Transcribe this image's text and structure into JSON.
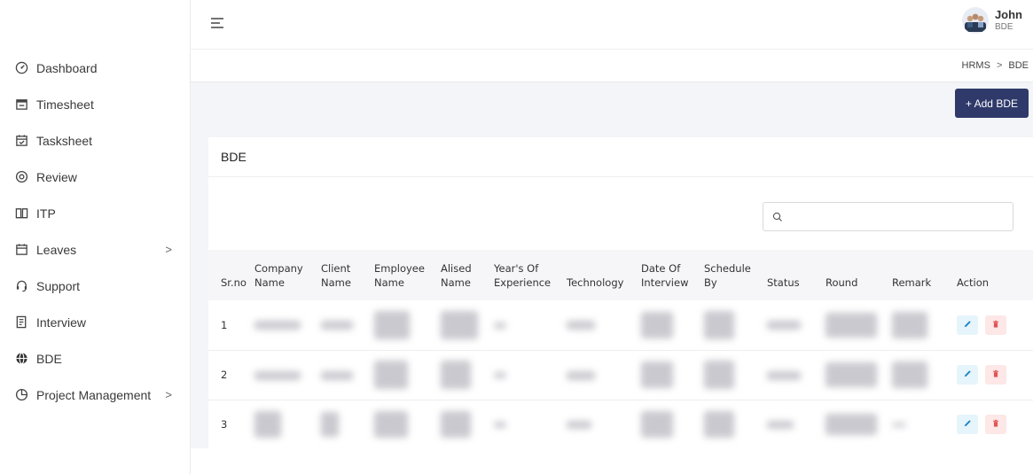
{
  "sidebar": {
    "items": [
      {
        "label": "Dashboard",
        "icon": "dashboard-icon",
        "arrow": ""
      },
      {
        "label": "Timesheet",
        "icon": "calendar-icon",
        "arrow": ""
      },
      {
        "label": "Tasksheet",
        "icon": "calendar-check-icon",
        "arrow": ""
      },
      {
        "label": "Review",
        "icon": "eye-icon",
        "arrow": ""
      },
      {
        "label": "ITP",
        "icon": "book-icon",
        "arrow": ""
      },
      {
        "label": "Leaves",
        "icon": "calendar-icon",
        "arrow": ">"
      },
      {
        "label": "Support",
        "icon": "headset-icon",
        "arrow": ""
      },
      {
        "label": "Interview",
        "icon": "document-icon",
        "arrow": ""
      },
      {
        "label": "BDE",
        "icon": "globe-icon",
        "arrow": ""
      },
      {
        "label": "Project Management",
        "icon": "pie-chart-icon",
        "arrow": ">"
      }
    ]
  },
  "header": {
    "user_name": "John",
    "user_role": "BDE"
  },
  "breadcrumb": {
    "root": "HRMS",
    "separator": ">",
    "current": "BDE"
  },
  "toolbar": {
    "add_label": "+ Add BDE"
  },
  "card": {
    "title": "BDE",
    "search_placeholder": ""
  },
  "table": {
    "columns": [
      {
        "l1": "",
        "l2": "Sr.no"
      },
      {
        "l1": "Company",
        "l2": "Name"
      },
      {
        "l1": "Client",
        "l2": "Name"
      },
      {
        "l1": "Employee",
        "l2": "Name"
      },
      {
        "l1": "Alised",
        "l2": "Name"
      },
      {
        "l1": "Year's Of",
        "l2": "Experience"
      },
      {
        "l1": "",
        "l2": "Technology"
      },
      {
        "l1": "Date Of",
        "l2": "Interview"
      },
      {
        "l1": "Schedule",
        "l2": "By"
      },
      {
        "l1": "",
        "l2": "Status"
      },
      {
        "l1": "",
        "l2": "Round"
      },
      {
        "l1": "",
        "l2": "Remark"
      },
      {
        "l1": "",
        "l2": "Action"
      }
    ],
    "rows": [
      {
        "srno": "1"
      },
      {
        "srno": "2"
      },
      {
        "srno": "3"
      }
    ]
  },
  "colors": {
    "accent": "#2f3a6a",
    "edit_bg": "#e6f4fb",
    "edit_icon": "#1e88c8",
    "delete_bg": "#fde7e7",
    "delete_icon": "#e05454",
    "content_bg": "#f4f5f8"
  }
}
